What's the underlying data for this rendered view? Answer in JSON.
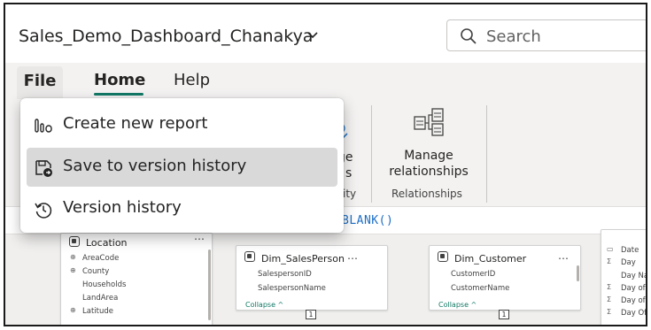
{
  "window": {
    "file_title": "Sales_Demo_Dashboard_Chanakya",
    "title_chevron_icon": "chevron-down-icon",
    "search": {
      "label": "Search",
      "icon": "search-icon"
    }
  },
  "ribbon": {
    "tabs": [
      {
        "label": "File",
        "state": "open"
      },
      {
        "label": "Home",
        "state": "selected"
      },
      {
        "label": "Help",
        "state": "normal"
      }
    ],
    "accent_color": "#117865",
    "partial_button": {
      "label_line1": "ge",
      "label_line2": "s",
      "group_label": "ity"
    },
    "manage_relationships": {
      "label_line1": "Manage",
      "label_line2": "relationships",
      "group_label": "Relationships",
      "icon": "manage-relationships-icon"
    }
  },
  "file_menu": {
    "items": [
      {
        "label": "Create new report",
        "icon": "report-bars-icon",
        "selected": false
      },
      {
        "label": "Save to version history",
        "icon": "save-version-icon",
        "selected": true
      },
      {
        "label": "Version history",
        "icon": "history-icon",
        "selected": false
      }
    ]
  },
  "formula_bar": {
    "text": "BLANK()"
  },
  "model": {
    "location_card": {
      "title": "Location",
      "fields": [
        "AreaCode",
        "County",
        "Households",
        "LandArea",
        "Latitude"
      ]
    },
    "salesperson_card": {
      "title": "Dim_SalesPerson",
      "fields": [
        "SalespersonID",
        "SalespersonName"
      ],
      "collapse_label": "Collapse ^",
      "relationship_badge": "1"
    },
    "customer_card": {
      "title": "Dim_Customer",
      "fields": [
        "CustomerID",
        "CustomerName"
      ],
      "collapse_label": "Collapse ^",
      "relationship_badge": "1"
    },
    "date_card": {
      "fields": [
        "Date",
        "Day",
        "Day Nam",
        "Day of W",
        "Day of Ye",
        "Day Off"
      ]
    }
  }
}
